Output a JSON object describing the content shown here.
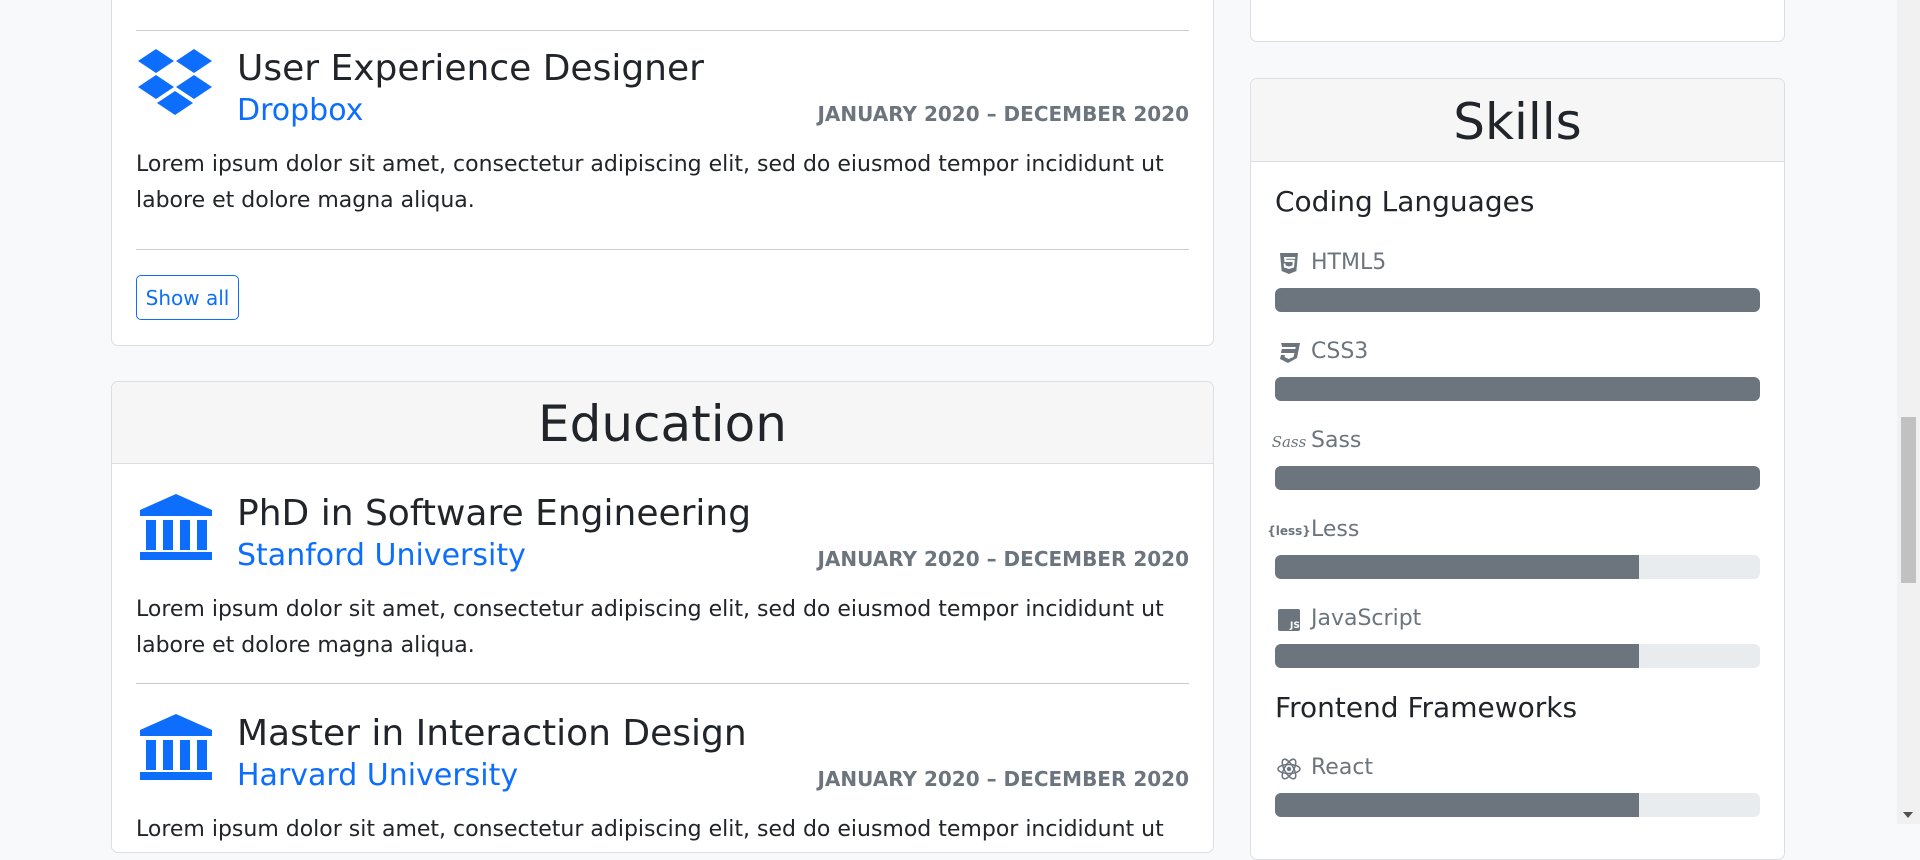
{
  "experience": {
    "partial_text": "...magna aliqua.",
    "entry": {
      "title": "User Experience Designer",
      "organization": "Dropbox",
      "dates": "January 2020 – December 2020",
      "description": "Lorem ipsum dolor sit amet, consectetur adipiscing elit, sed do eiusmod tempor incididunt ut labore et dolore magna aliqua.",
      "logo_icon": "dropbox-icon"
    },
    "show_all_label": "Show all"
  },
  "education": {
    "heading": "Education",
    "entries": [
      {
        "title": "PhD in Software Engineering",
        "organization": "Stanford University",
        "dates": "January 2020 – December 2020",
        "description": "Lorem ipsum dolor sit amet, consectetur adipiscing elit, sed do eiusmod tempor incididunt ut labore et dolore magna aliqua.",
        "logo_icon": "university-icon"
      },
      {
        "title": "Master in Interaction Design",
        "organization": "Harvard University",
        "dates": "January 2020 – December 2020",
        "description": "Lorem ipsum dolor sit amet, consectetur adipiscing elit, sed do eiusmod tempor incididunt ut labore et dolore magna aliqua.",
        "logo_icon": "university-icon"
      }
    ]
  },
  "skills": {
    "heading": "Skills",
    "groups": [
      {
        "title": "Coding Languages",
        "items": [
          {
            "name": "HTML5",
            "icon": "html5-icon",
            "level_percent": 100
          },
          {
            "name": "CSS3",
            "icon": "css3-icon",
            "level_percent": 100
          },
          {
            "name": "Sass",
            "icon": "sass-icon",
            "level_percent": 100
          },
          {
            "name": "Less",
            "icon": "less-icon",
            "level_percent": 75
          },
          {
            "name": "JavaScript",
            "icon": "javascript-icon",
            "level_percent": 75
          }
        ]
      },
      {
        "title": "Frontend Frameworks",
        "items": [
          {
            "name": "React",
            "icon": "react-icon",
            "level_percent": 75
          }
        ]
      }
    ]
  },
  "colors": {
    "accent": "#0d6efd",
    "muted": "#6c757d",
    "track": "#e9ecef",
    "background": "#f8f9fa"
  }
}
